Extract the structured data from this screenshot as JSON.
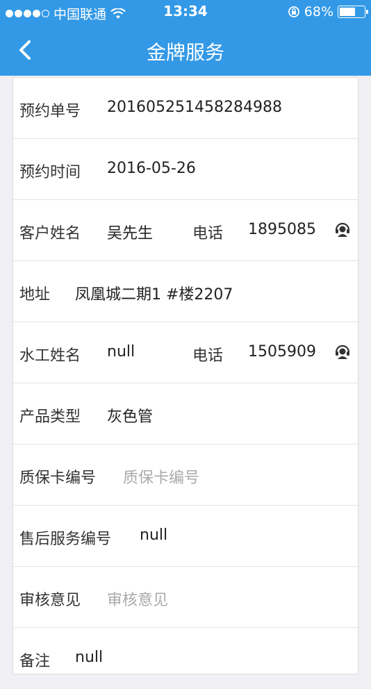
{
  "status_bar": {
    "carrier": "中国联通",
    "time": "13:34",
    "battery_percent": "68%",
    "battery_level": 0.68
  },
  "nav": {
    "title": "金牌服务",
    "back_icon": "chevron-left-icon"
  },
  "rows": {
    "order_no": {
      "label": "预约单号",
      "value": "201605251458284988"
    },
    "order_time": {
      "label": "预约时间",
      "value": "2016-05-26"
    },
    "customer": {
      "label": "客户姓名",
      "value": "吴先生",
      "phone_label": "电话",
      "phone": "1895085"
    },
    "address": {
      "label": "地址",
      "value": "凤凰城二期1 #楼2207"
    },
    "plumber": {
      "label": "水工姓名",
      "value": "null",
      "phone_label": "电话",
      "phone": "1505909"
    },
    "product": {
      "label": "产品类型",
      "value": "灰色管"
    },
    "warranty": {
      "label": "质保卡编号",
      "placeholder": "质保卡编号"
    },
    "service_no": {
      "label": "售后服务编号",
      "value": "null"
    },
    "review": {
      "label": "审核意见",
      "placeholder": "审核意见"
    },
    "remark": {
      "label": "备注",
      "value": "null"
    }
  },
  "colors": {
    "header": "#3399e6",
    "icon": "#333333"
  }
}
